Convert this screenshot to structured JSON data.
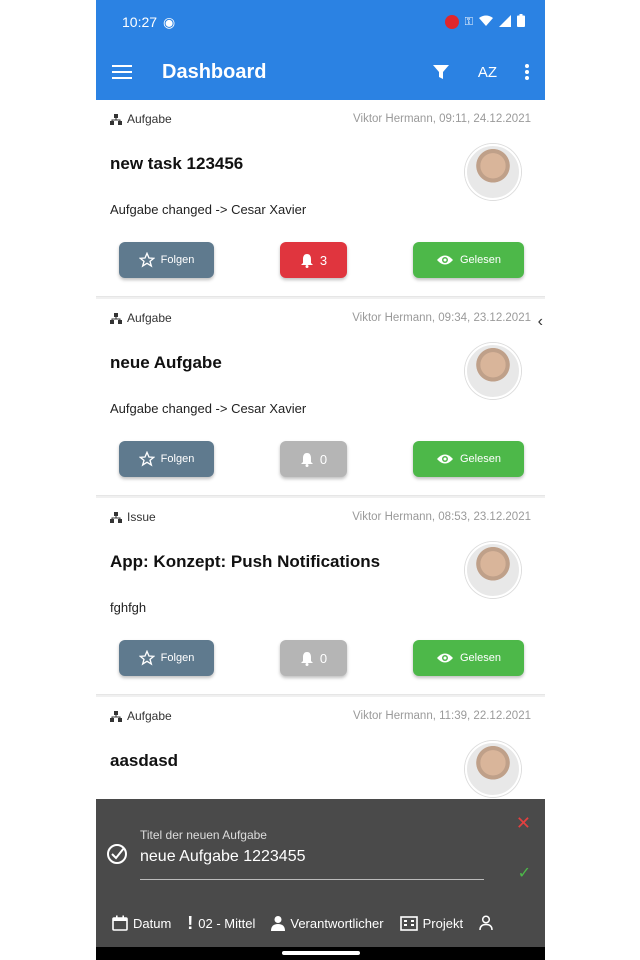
{
  "status_bar": {
    "time": "10:27"
  },
  "app_bar": {
    "title": "Dashboard",
    "sort_label": "AZ"
  },
  "cards": [
    {
      "type": "Aufgabe",
      "author": "Viktor Hermann, 09:11, 24.12.2021",
      "title": "new task 123456",
      "description": "Aufgabe changed  -> Cesar Xavier",
      "follow_label": "Folgen",
      "bell_count": "3",
      "bell_color": "red",
      "read_label": "Gelesen"
    },
    {
      "type": "Aufgabe",
      "author": "Viktor Hermann, 09:34, 23.12.2021",
      "title": "neue Aufgabe",
      "description": "Aufgabe changed  -> Cesar Xavier",
      "follow_label": "Folgen",
      "bell_count": "0",
      "bell_color": "grey",
      "read_label": "Gelesen"
    },
    {
      "type": "Issue",
      "author": "Viktor Hermann, 08:53, 23.12.2021",
      "title": "App: Konzept: Push Notifications",
      "description": "fghfgh",
      "follow_label": "Folgen",
      "bell_count": "0",
      "bell_color": "grey",
      "read_label": "Gelesen"
    },
    {
      "type": "Aufgabe",
      "author": "Viktor Hermann, 11:39, 22.12.2021",
      "title": "aasdasd",
      "description": "",
      "follow_label": "",
      "bell_count": "",
      "bell_color": "grey",
      "read_label": ""
    }
  ],
  "composer": {
    "label": "Titel der neuen Aufgabe",
    "value": "neue Aufgabe 1223455",
    "tools": {
      "date": "Datum",
      "priority": "02 - Mittel",
      "responsible": "Verantwortlicher",
      "project": "Projekt"
    }
  },
  "colors": {
    "primary": "#2b82e3",
    "follow": "#5f7a8e",
    "read": "#4db849",
    "bell_active": "#e0353e",
    "bell_inactive": "#b5b5b5"
  }
}
